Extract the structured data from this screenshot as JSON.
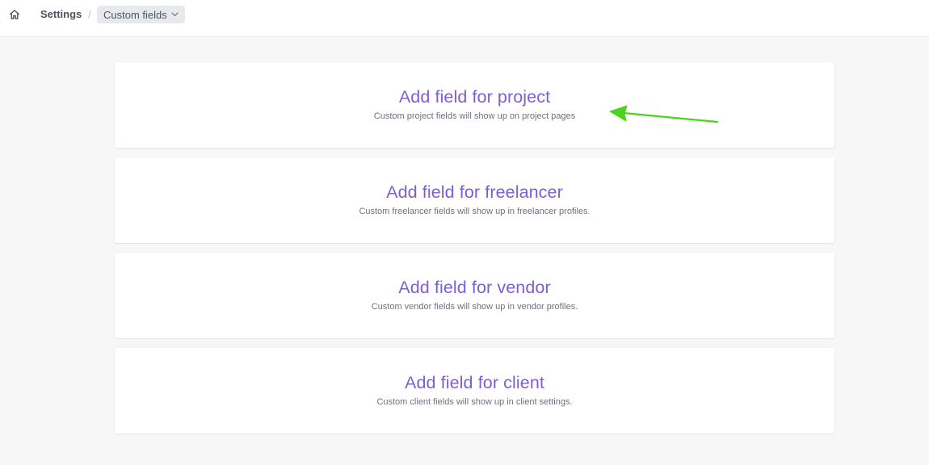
{
  "breadcrumb": {
    "home_icon": "home-icon",
    "settings_label": "Settings",
    "separator": "/",
    "current_label": "Custom fields",
    "current_dropdown_icon": "chevron-down-icon"
  },
  "cards": [
    {
      "title": "Add field for project",
      "subtitle": "Custom project fields will show up on project pages"
    },
    {
      "title": "Add field for freelancer",
      "subtitle": "Custom freelancer fields will show up in freelancer profiles."
    },
    {
      "title": "Add field for vendor",
      "subtitle": "Custom vendor fields will show up in vendor profiles."
    },
    {
      "title": "Add field for client",
      "subtitle": "Custom client fields will show up in client settings."
    }
  ],
  "colors": {
    "accent": "#7c5fd3",
    "annotation_arrow": "#4cd41c",
    "background": "#f7f7f8"
  }
}
